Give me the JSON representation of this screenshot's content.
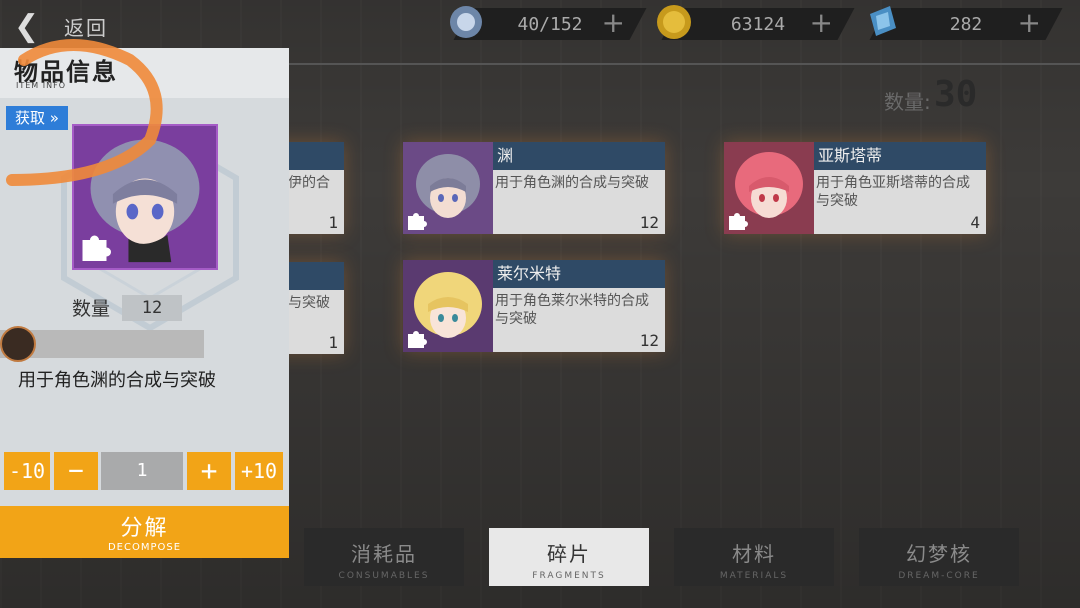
{
  "topbar": {
    "back_label": "返回",
    "resources": [
      {
        "icon": "stamina-icon",
        "value": "40/152"
      },
      {
        "icon": "coin-icon",
        "value": "63124"
      },
      {
        "icon": "crystal-icon",
        "value": "282"
      }
    ],
    "plus": "+"
  },
  "inventory": {
    "count_label": "数量:",
    "count_value": "30",
    "cards": [
      {
        "name": "",
        "desc": "伊的合",
        "qty": "1"
      },
      {
        "name": "渊",
        "desc": "用于角色渊的合成与突破",
        "qty": "12"
      },
      {
        "name": "亚斯塔蒂",
        "desc": "用于角色亚斯塔蒂的合成与突破",
        "qty": "4"
      },
      {
        "name": "",
        "desc": "与突破",
        "qty": "1"
      },
      {
        "name": "莱尔米特",
        "desc": "用于角色莱尔米特的合成与突破",
        "qty": "12"
      }
    ]
  },
  "tabs": [
    {
      "zh": "消耗品",
      "en": "CONSUMABLES"
    },
    {
      "zh": "碎片",
      "en": "FRAGMENTS"
    },
    {
      "zh": "材料",
      "en": "MATERIALS"
    },
    {
      "zh": "幻梦核",
      "en": "DREAM-CORE"
    }
  ],
  "panel": {
    "title": "物品信息",
    "subtitle": "ITEM INFO",
    "get_label": "获取 »",
    "qty_label": "数量",
    "qty_value": "12",
    "description": "用于角色渊的合成与突破",
    "minus10": "-10",
    "minus": "−",
    "amount": "1",
    "plus": "+",
    "plus10": "+10",
    "decompose_zh": "分解",
    "decompose_en": "DECOMPOSE"
  },
  "colors": {
    "accent": "#f2a417",
    "header_blue": "#2f4a66",
    "get_blue": "#2e7dd8"
  }
}
